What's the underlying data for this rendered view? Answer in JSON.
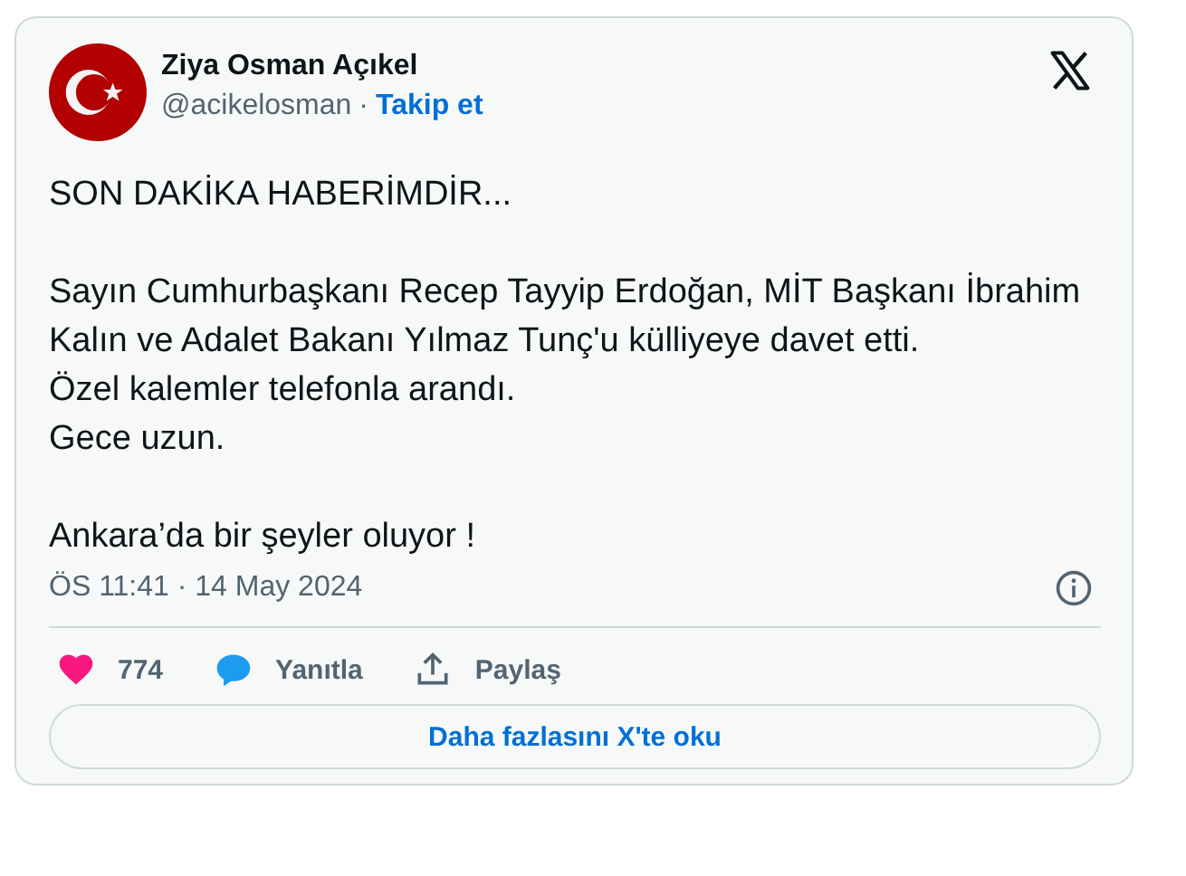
{
  "author": {
    "name": "Ziya Osman Açıkel",
    "handle": "@acikelosman",
    "separator": "·",
    "follow": "Takip et"
  },
  "paragraphs": [
    [
      "SON DAKİKA HABERİMDİR..."
    ],
    [
      "Sayın Cumhurbaşkanı Recep Tayyip Erdoğan, MİT Başkanı İbrahim Kalın ve Adalet Bakanı Yılmaz Tunç'u külliyeye davet etti.",
      "Özel kalemler telefonla arandı.",
      "Gece uzun."
    ],
    [
      "Ankara’da bir şeyler oluyor !"
    ]
  ],
  "timestamp": "ÖS 11:41 · 14 May 2024",
  "actions": [
    {
      "kind": "like",
      "label": "774"
    },
    {
      "kind": "reply",
      "label": "Yanıtla"
    },
    {
      "kind": "share",
      "label": "Paylaş"
    }
  ],
  "read_more": "Daha fazlasını X'te oku"
}
